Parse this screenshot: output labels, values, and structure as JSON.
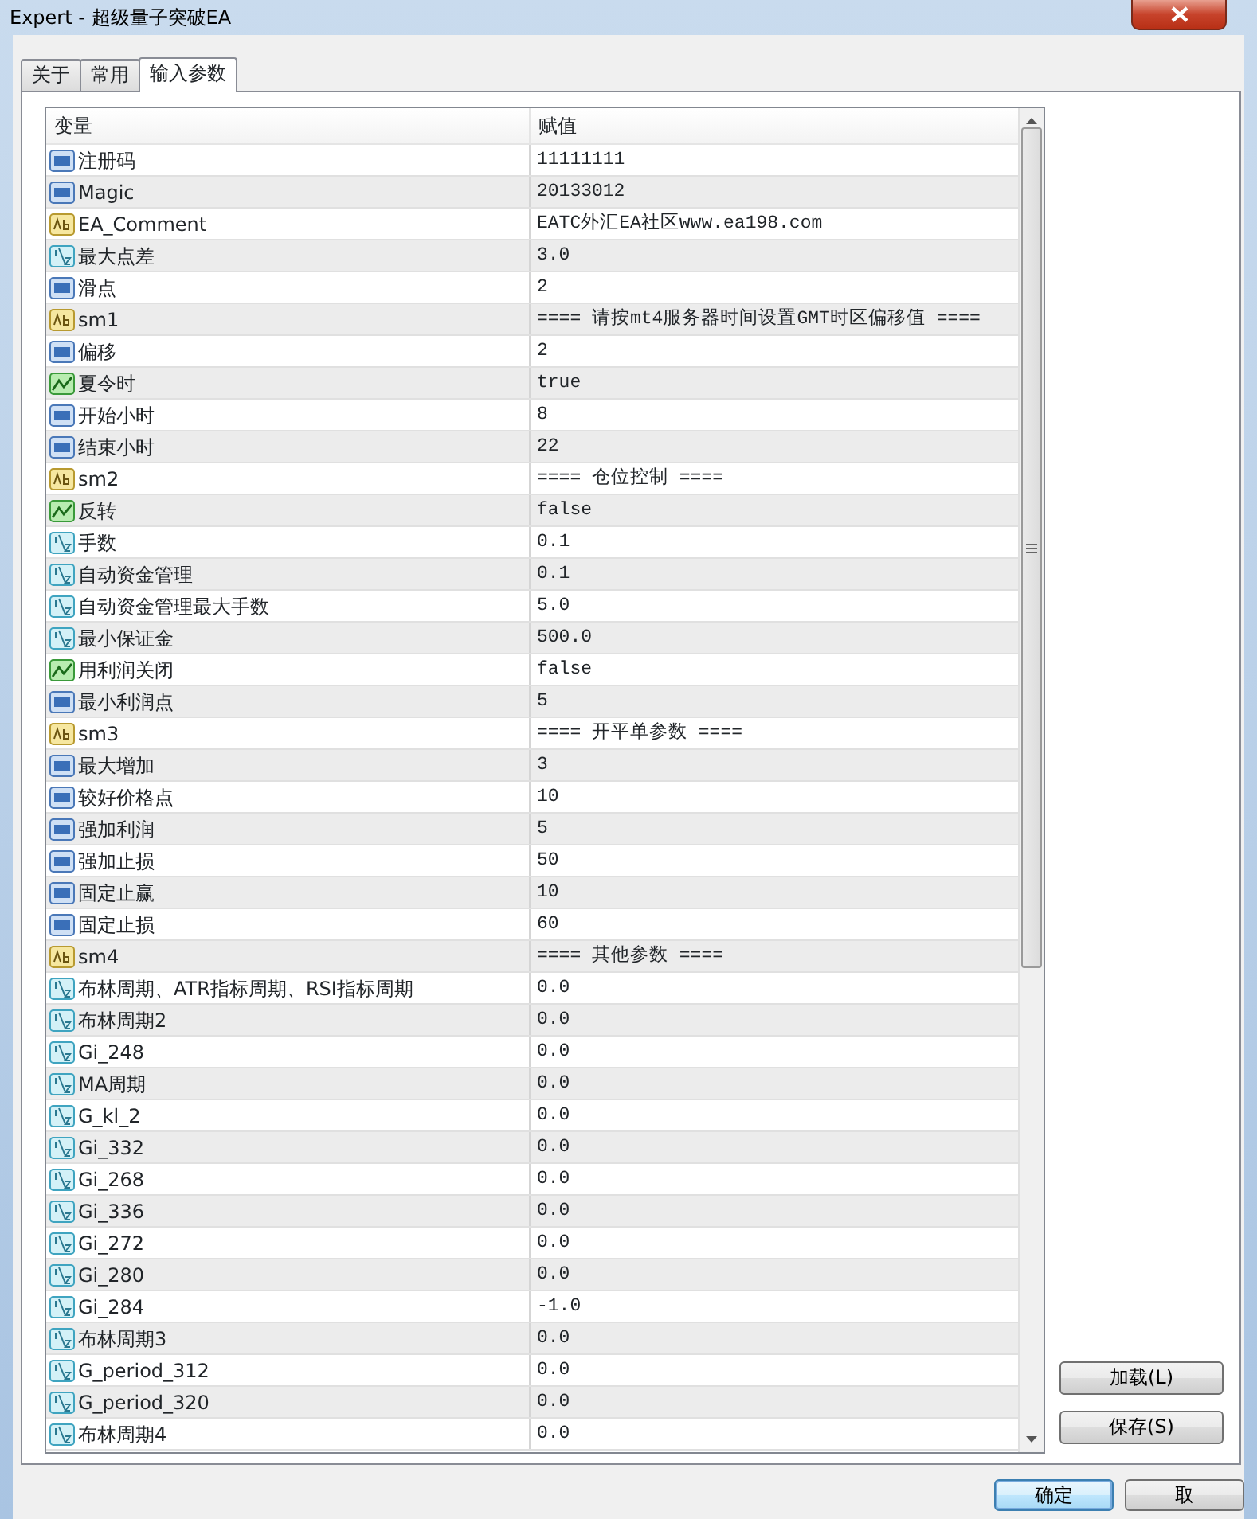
{
  "window": {
    "title": "Expert - 超级量子突破EA"
  },
  "tabs": [
    {
      "label": "关于",
      "selected": false
    },
    {
      "label": "常用",
      "selected": false
    },
    {
      "label": "输入参数",
      "selected": true
    }
  ],
  "table": {
    "columns": [
      "变量",
      "赋值"
    ],
    "rows": [
      {
        "kind": "int",
        "name": "注册码",
        "value": "11111111"
      },
      {
        "kind": "int",
        "name": "Magic",
        "value": "20133012"
      },
      {
        "kind": "string",
        "name": "EA_Comment",
        "value": "EATC外汇EA社区www.ea198.com"
      },
      {
        "kind": "double",
        "name": "最大点差",
        "value": "3.0"
      },
      {
        "kind": "int",
        "name": "滑点",
        "value": "2"
      },
      {
        "kind": "string",
        "name": "sm1",
        "value": "==== 请按mt4服务器时间设置GMT时区偏移值 ===="
      },
      {
        "kind": "int",
        "name": "偏移",
        "value": "2"
      },
      {
        "kind": "bool",
        "name": "夏令时",
        "value": "true"
      },
      {
        "kind": "int",
        "name": "开始小时",
        "value": "8"
      },
      {
        "kind": "int",
        "name": "结束小时",
        "value": "22"
      },
      {
        "kind": "string",
        "name": "sm2",
        "value": "==== 仓位控制 ===="
      },
      {
        "kind": "bool",
        "name": "反转",
        "value": "false"
      },
      {
        "kind": "double",
        "name": "手数",
        "value": "0.1"
      },
      {
        "kind": "double",
        "name": "自动资金管理",
        "value": "0.1"
      },
      {
        "kind": "double",
        "name": "自动资金管理最大手数",
        "value": "5.0"
      },
      {
        "kind": "double",
        "name": "最小保证金",
        "value": "500.0"
      },
      {
        "kind": "bool",
        "name": "用利润关闭",
        "value": "false"
      },
      {
        "kind": "int",
        "name": "最小利润点",
        "value": "5"
      },
      {
        "kind": "string",
        "name": "sm3",
        "value": "==== 开平单参数 ===="
      },
      {
        "kind": "int",
        "name": "最大增加",
        "value": "3"
      },
      {
        "kind": "int",
        "name": "较好价格点",
        "value": "10"
      },
      {
        "kind": "int",
        "name": "强加利润",
        "value": "5"
      },
      {
        "kind": "int",
        "name": "强加止损",
        "value": "50"
      },
      {
        "kind": "int",
        "name": "固定止赢",
        "value": "10"
      },
      {
        "kind": "int",
        "name": "固定止损",
        "value": "60"
      },
      {
        "kind": "string",
        "name": "sm4",
        "value": "==== 其他参数 ===="
      },
      {
        "kind": "double",
        "name": "布林周期、ATR指标周期、RSI指标周期",
        "value": "0.0"
      },
      {
        "kind": "double",
        "name": "布林周期2",
        "value": "0.0"
      },
      {
        "kind": "double",
        "name": "Gi_248",
        "value": "0.0"
      },
      {
        "kind": "double",
        "name": "MA周期",
        "value": "0.0"
      },
      {
        "kind": "double",
        "name": "G_kl_2",
        "value": "0.0"
      },
      {
        "kind": "double",
        "name": "Gi_332",
        "value": "0.0"
      },
      {
        "kind": "double",
        "name": "Gi_268",
        "value": "0.0"
      },
      {
        "kind": "double",
        "name": "Gi_336",
        "value": "0.0"
      },
      {
        "kind": "double",
        "name": "Gi_272",
        "value": "0.0"
      },
      {
        "kind": "double",
        "name": "Gi_280",
        "value": "0.0"
      },
      {
        "kind": "double",
        "name": "Gi_284",
        "value": "-1.0"
      },
      {
        "kind": "double",
        "name": "布林周期3",
        "value": "0.0"
      },
      {
        "kind": "double",
        "name": "G_period_312",
        "value": "0.0"
      },
      {
        "kind": "double",
        "name": "G_period_320",
        "value": "0.0"
      },
      {
        "kind": "double",
        "name": "布林周期4",
        "value": "0.0"
      }
    ]
  },
  "side_buttons": [
    "加载(L)",
    "保存(S)"
  ],
  "footer_buttons": [
    {
      "label": "确定",
      "default": true
    },
    {
      "label": "取",
      "default": false
    }
  ]
}
